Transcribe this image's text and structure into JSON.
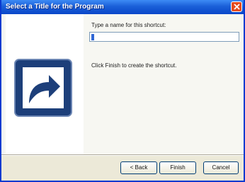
{
  "window": {
    "title": "Select a Title for the Program",
    "accent": "#0a47c9",
    "close_icon": "close-icon"
  },
  "main": {
    "prompt": "Type a name for this shortcut:",
    "shortcut_name": "",
    "finish_hint": "Click Finish to create the shortcut.",
    "icon": "shortcut-arrow-icon"
  },
  "buttons": {
    "back": "< Back",
    "finish": "Finish",
    "cancel": "Cancel"
  }
}
